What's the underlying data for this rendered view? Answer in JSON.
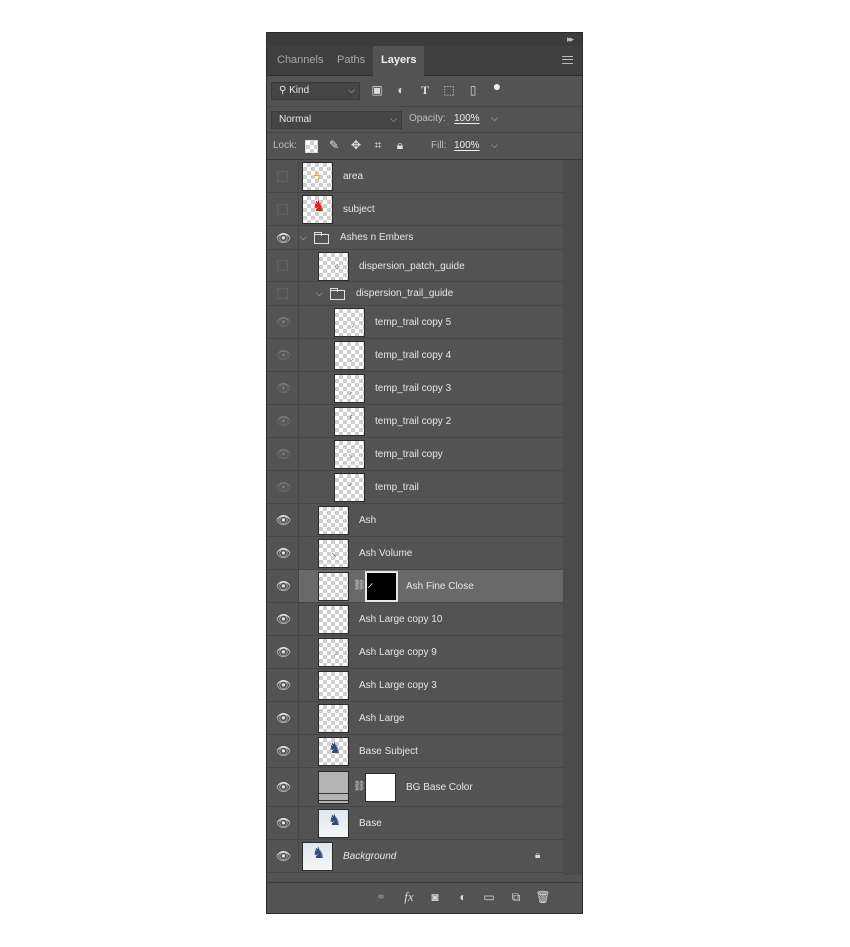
{
  "tabs": [
    {
      "label": "Channels"
    },
    {
      "label": "Paths"
    },
    {
      "label": "Layers"
    }
  ],
  "filter": {
    "kind_label": "Kind",
    "icons": [
      "image-filter-icon",
      "adjustment-filter-icon",
      "type-filter-icon",
      "shape-filter-icon",
      "smart-object-filter-icon",
      "filter-toggle-icon"
    ]
  },
  "blend": {
    "mode": "Normal",
    "opacity_label": "Opacity:",
    "opacity_value": "100%"
  },
  "lock": {
    "label": "Lock:",
    "icons": [
      "lock-transparent-pixels-icon",
      "lock-image-pixels-icon",
      "lock-position-icon",
      "lock-artboard-icon",
      "lock-all-icon"
    ],
    "fill_label": "Fill:",
    "fill_value": "100%"
  },
  "layers": [
    {
      "name": "area",
      "visible": false,
      "depth": 0
    },
    {
      "name": "subject",
      "visible": false,
      "depth": 0
    },
    {
      "name": "Ashes n Embers",
      "visible": true,
      "depth": 0,
      "group": true
    },
    {
      "name": "dispersion_patch_guide",
      "visible": false,
      "depth": 1
    },
    {
      "name": "dispersion_trail_guide",
      "visible": false,
      "depth": 1,
      "group": true
    },
    {
      "name": "temp_trail copy 5",
      "visible": true,
      "dim": true,
      "depth": 2
    },
    {
      "name": "temp_trail copy 4",
      "visible": true,
      "dim": true,
      "depth": 2
    },
    {
      "name": "temp_trail copy 3",
      "visible": true,
      "dim": true,
      "depth": 2
    },
    {
      "name": "temp_trail copy 2",
      "visible": true,
      "dim": true,
      "depth": 2
    },
    {
      "name": "temp_trail copy",
      "visible": true,
      "dim": true,
      "depth": 2
    },
    {
      "name": "temp_trail",
      "visible": true,
      "dim": true,
      "depth": 2
    },
    {
      "name": "Ash",
      "visible": true,
      "depth": 1
    },
    {
      "name": "Ash Volume",
      "visible": true,
      "depth": 1
    },
    {
      "name": "Ash Fine Close",
      "visible": true,
      "depth": 1,
      "selected": true,
      "mask": "black"
    },
    {
      "name": "Ash Large copy 10",
      "visible": true,
      "depth": 1
    },
    {
      "name": "Ash Large copy 9",
      "visible": true,
      "depth": 1
    },
    {
      "name": "Ash Large copy 3",
      "visible": true,
      "depth": 1
    },
    {
      "name": "Ash Large",
      "visible": true,
      "depth": 1
    },
    {
      "name": "Base Subject",
      "visible": true,
      "depth": 1
    },
    {
      "name": "BG Base Color",
      "visible": true,
      "depth": 1,
      "mask": "white"
    },
    {
      "name": "Base",
      "visible": true,
      "depth": 1
    },
    {
      "name": "Background",
      "visible": true,
      "depth": 0,
      "locked": true,
      "italic": true
    }
  ],
  "bottom_icons": [
    "link-layers-icon",
    "fx-icon",
    "add-mask-icon",
    "new-adjustment-icon",
    "new-group-icon",
    "new-layer-icon",
    "delete-layer-icon"
  ],
  "colors": {
    "panel_bg": "#535353",
    "selected_row": "#696969",
    "tab_bar": "#3f3f3f"
  }
}
